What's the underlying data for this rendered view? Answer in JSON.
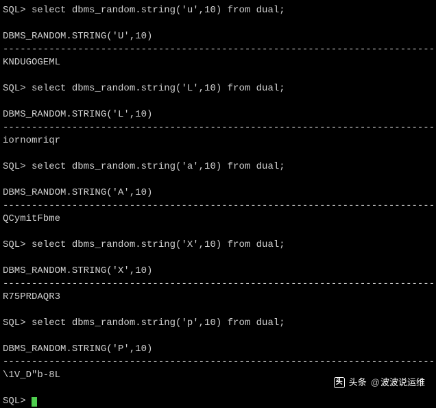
{
  "prompt": "SQL> ",
  "divider": "---------------------------------------------------------------------------------------",
  "blocks": [
    {
      "query": "select dbms_random.string('u',10) from dual;",
      "header": "DBMS_RANDOM.STRING('U',10)",
      "result": "KNDUGOGEML"
    },
    {
      "query": "select dbms_random.string('L',10) from dual;",
      "header": "DBMS_RANDOM.STRING('L',10)",
      "result": "iornomriqr"
    },
    {
      "query": "select dbms_random.string('a',10) from dual;",
      "header": "DBMS_RANDOM.STRING('A',10)",
      "result": "QCymitFbme"
    },
    {
      "query": "select dbms_random.string('X',10) from dual;",
      "header": "DBMS_RANDOM.STRING('X',10)",
      "result": "R75PRDAQR3"
    },
    {
      "query": "select dbms_random.string('p',10) from dual;",
      "header": "DBMS_RANDOM.STRING('P',10)",
      "result": "\\1V_D\"b-8L"
    }
  ],
  "final_prompt": "SQL> ",
  "footer": {
    "icon": "头",
    "label": "头条",
    "at": "@",
    "user": "波波说运维"
  }
}
